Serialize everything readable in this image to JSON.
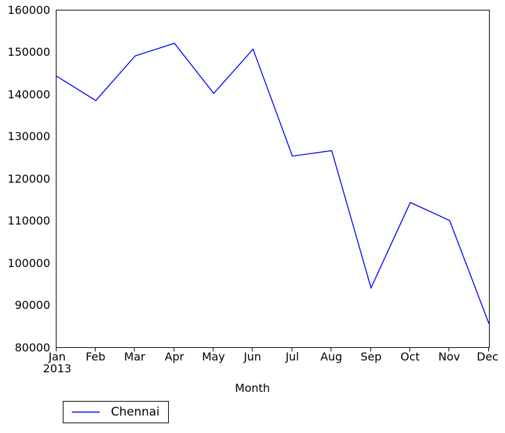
{
  "chart_data": {
    "type": "line",
    "title": "",
    "xlabel": "Month",
    "ylabel": "",
    "x_axis_year": "2013",
    "categories": [
      "Jan",
      "Feb",
      "Mar",
      "Apr",
      "May",
      "Jun",
      "Jul",
      "Aug",
      "Sep",
      "Oct",
      "Nov",
      "Dec"
    ],
    "xtick_labels": [
      "Jan",
      "Feb",
      "Mar",
      "Apr",
      "May",
      "Jun",
      "Jul",
      "Aug",
      "Sep",
      "Oct",
      "Nov",
      "Dec"
    ],
    "ytick_labels": [
      "160000",
      "150000",
      "140000",
      "130000",
      "120000",
      "110000",
      "100000",
      "90000",
      "80000"
    ],
    "ytick_values": [
      160000,
      150000,
      140000,
      130000,
      120000,
      110000,
      100000,
      90000,
      80000
    ],
    "ylim": [
      80000,
      160000
    ],
    "grid": false,
    "legend_position": "below-left",
    "series": [
      {
        "name": "Chennai",
        "color": "#0000ff",
        "values": [
          144400,
          138600,
          149200,
          152200,
          140300,
          150800,
          125400,
          126700,
          94100,
          114400,
          110100,
          85600
        ]
      }
    ]
  },
  "legend": {
    "entries": [
      {
        "label": "Chennai",
        "color": "#0000ff"
      }
    ]
  }
}
